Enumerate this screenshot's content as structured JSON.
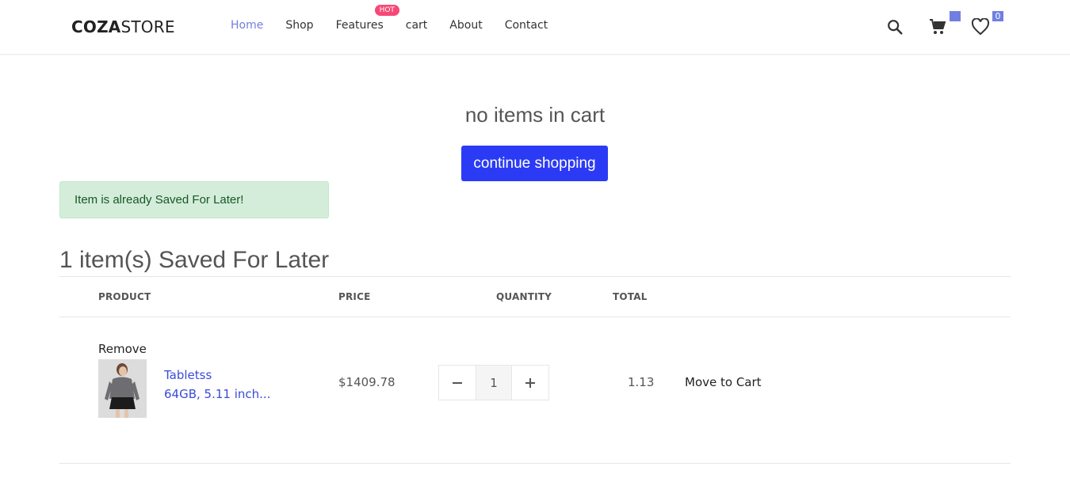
{
  "brand": {
    "strong": "COZA",
    "light": "STORE"
  },
  "nav": {
    "items": [
      "Home",
      "Shop",
      "Features",
      "cart",
      "About",
      "Contact"
    ],
    "hot_badge": "HOT"
  },
  "header_icons": {
    "search": "search-icon",
    "cart": "cart-icon",
    "cart_count": "",
    "wishlist": "heart-icon",
    "wishlist_count": "0"
  },
  "cart": {
    "empty_message": "no items in cart",
    "continue_label": "continue shopping"
  },
  "alert": {
    "message": "Item is already Saved For Later!"
  },
  "saved": {
    "title": "1 item(s) Saved For Later",
    "columns": [
      "PRODUCT",
      "PRICE",
      "QUANTITY",
      "TOTAL"
    ],
    "items": [
      {
        "remove_label": "Remove",
        "name_line1": "Tabletss",
        "name_line2": "64GB, 5.11 inch...",
        "price": "$1409.78",
        "quantity": "1",
        "total": "1.13",
        "move_label": "Move to Cart"
      }
    ]
  },
  "colors": {
    "accent": "#717fe0",
    "button": "#2b3bf5",
    "hot": "#f74877",
    "alert_bg": "#d4edda",
    "alert_text": "#155724",
    "link": "#3a4bd8"
  }
}
